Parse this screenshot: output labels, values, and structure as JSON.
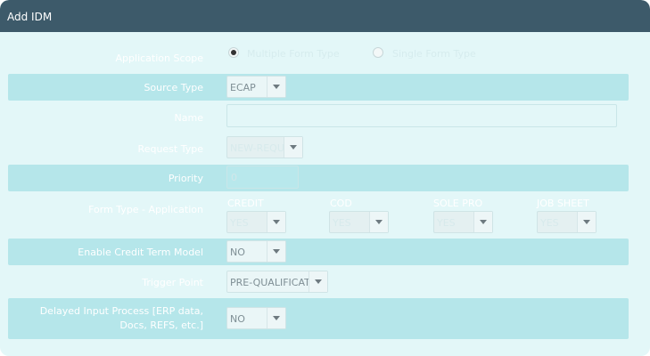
{
  "header": {
    "title": "Add IDM"
  },
  "application_scope": {
    "label": "Application Scope",
    "options": [
      {
        "label": "Multiple Form Type",
        "selected": true
      },
      {
        "label": "Single Form Type",
        "selected": false
      }
    ]
  },
  "source_type": {
    "label": "Source Type",
    "value": "ECAP"
  },
  "name": {
    "label": "Name",
    "value": ""
  },
  "request_type": {
    "label": "Request Type",
    "value": "NEW-REQU"
  },
  "priority": {
    "label": "Priority",
    "value": "0"
  },
  "form_type_application": {
    "label": "Form Type - Application",
    "columns": [
      {
        "header": "CREDIT",
        "value": "YES"
      },
      {
        "header": "COD",
        "value": "YES"
      },
      {
        "header": "SOLE PRO",
        "value": "YES"
      },
      {
        "header": "JOB SHEET",
        "value": "YES"
      }
    ]
  },
  "enable_credit_term_model": {
    "label": "Enable Credit Term Model",
    "value": "NO"
  },
  "trigger_point": {
    "label": "Trigger Point",
    "value": "PRE-QUALIFICAT"
  },
  "delayed_input_process": {
    "label_line1": "Delayed Input Process [ERP data,",
    "label_line2": "Docs, REFS, etc.]",
    "value": "NO"
  },
  "colors": {
    "header_bg": "#3d5a6a",
    "panel_bg": "#e3f7f8",
    "band_bg": "#b5e6ea"
  }
}
